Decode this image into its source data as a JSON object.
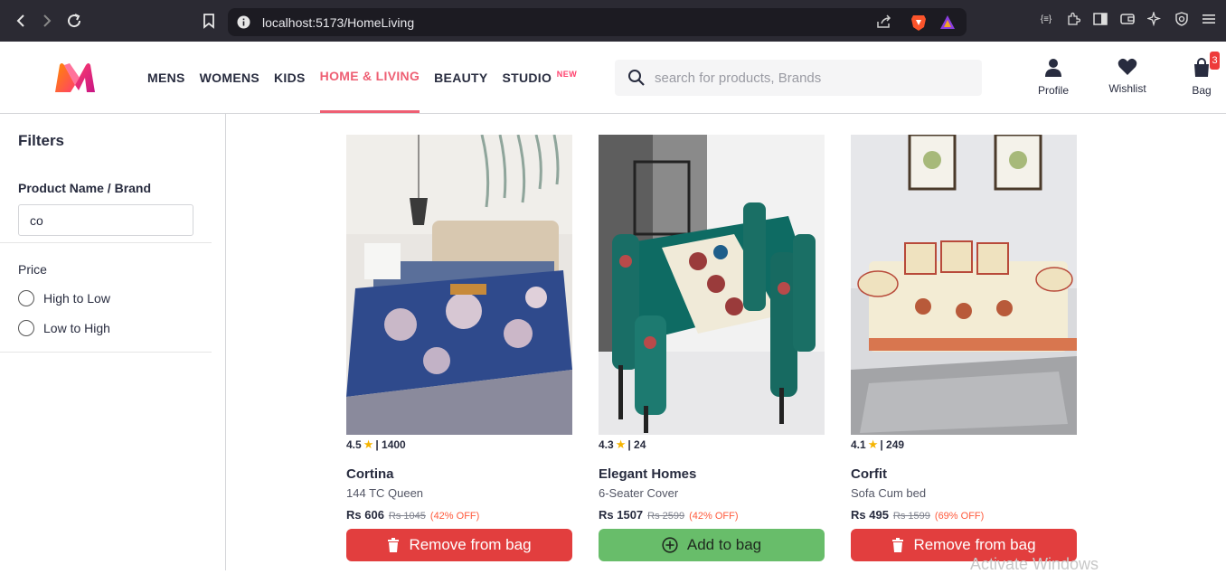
{
  "browser": {
    "url": "localhost:5173/HomeLiving"
  },
  "header": {
    "nav": [
      {
        "label": "MENS"
      },
      {
        "label": "WOMENS"
      },
      {
        "label": "KIDS"
      },
      {
        "label": "HOME & LIVING",
        "active": true
      },
      {
        "label": "BEAUTY"
      },
      {
        "label": "STUDIO",
        "badge": "NEW"
      }
    ],
    "search_placeholder": "search for products, Brands",
    "actions": {
      "profile": "Profile",
      "wishlist": "Wishlist",
      "bag": "Bag",
      "bag_count": "3"
    },
    "accent_color": "#ee5f73"
  },
  "sidebar": {
    "title": "Filters",
    "name_label": "Product Name / Brand",
    "name_value": "co",
    "price_label": "Price",
    "price_options": [
      "High to Low",
      "Low to High"
    ]
  },
  "products": [
    {
      "rating": "4.5",
      "rating_count": "| 1400",
      "brand": "Cortina",
      "desc": "144 TC Queen",
      "price": "Rs 606",
      "mrp": "Rs 1045",
      "discount": "(42% OFF)",
      "button": "Remove from bag",
      "button_type": "remove"
    },
    {
      "rating": "4.3",
      "rating_count": "| 24",
      "brand": "Elegant Homes",
      "desc": "6-Seater Cover",
      "price": "Rs 1507",
      "mrp": "Rs 2599",
      "discount": "(42% OFF)",
      "button": "Add to bag",
      "button_type": "add"
    },
    {
      "rating": "4.1",
      "rating_count": "| 249",
      "brand": "Corfit",
      "desc": "Sofa Cum bed",
      "price": "Rs 495",
      "mrp": "Rs 1599",
      "discount": "(69% OFF)",
      "button": "Remove from bag",
      "button_type": "remove"
    }
  ],
  "watermark": "Activate Windows"
}
